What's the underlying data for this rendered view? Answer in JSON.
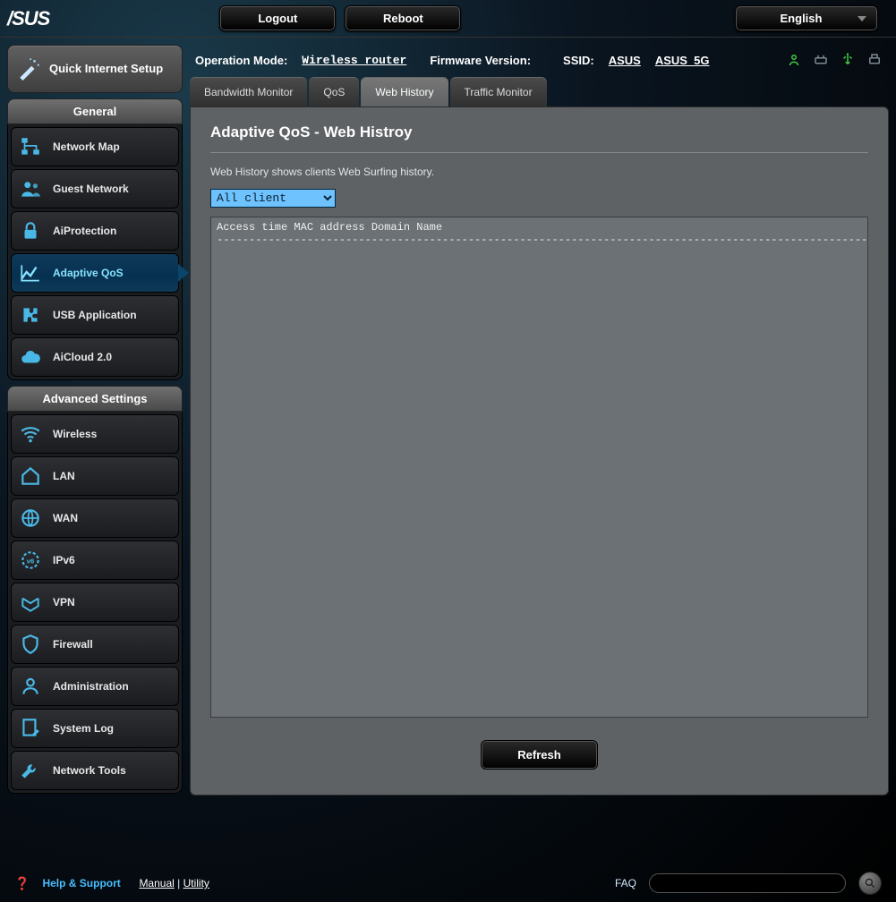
{
  "topbar": {
    "logout": "Logout",
    "reboot": "Reboot",
    "language": "English"
  },
  "leftcol": {
    "quick_setup": "Quick Internet Setup",
    "general_head": "General",
    "advanced_head": "Advanced Settings",
    "general_items": [
      {
        "label": "Network Map"
      },
      {
        "label": "Guest Network"
      },
      {
        "label": "AiProtection"
      },
      {
        "label": "Adaptive QoS",
        "active": true
      },
      {
        "label": "USB Application"
      },
      {
        "label": "AiCloud 2.0"
      }
    ],
    "advanced_items": [
      {
        "label": "Wireless"
      },
      {
        "label": "LAN"
      },
      {
        "label": "WAN"
      },
      {
        "label": "IPv6"
      },
      {
        "label": "VPN"
      },
      {
        "label": "Firewall"
      },
      {
        "label": "Administration"
      },
      {
        "label": "System Log"
      },
      {
        "label": "Network Tools"
      }
    ]
  },
  "status": {
    "op_mode_label": "Operation Mode:",
    "op_mode_value": "Wireless router",
    "fw_label": "Firmware Version:",
    "ssid_label": "SSID:",
    "ssid1": "ASUS",
    "ssid2": "ASUS_5G"
  },
  "tabs": [
    {
      "label": "Bandwidth Monitor"
    },
    {
      "label": "QoS"
    },
    {
      "label": "Web History",
      "active": true
    },
    {
      "label": "Traffic Monitor"
    }
  ],
  "panel": {
    "title": "Adaptive QoS - Web Histroy",
    "desc": "Web History shows clients Web Surfing history.",
    "client_selected": "All client",
    "history_header": "Access time MAC address Domain Name\n---------------------------------------------------------------------------------------------------------------------",
    "refresh": "Refresh"
  },
  "footer": {
    "help": "Help & Support",
    "manual": "Manual",
    "utility": "Utility",
    "faq": "FAQ",
    "search_placeholder": ""
  }
}
